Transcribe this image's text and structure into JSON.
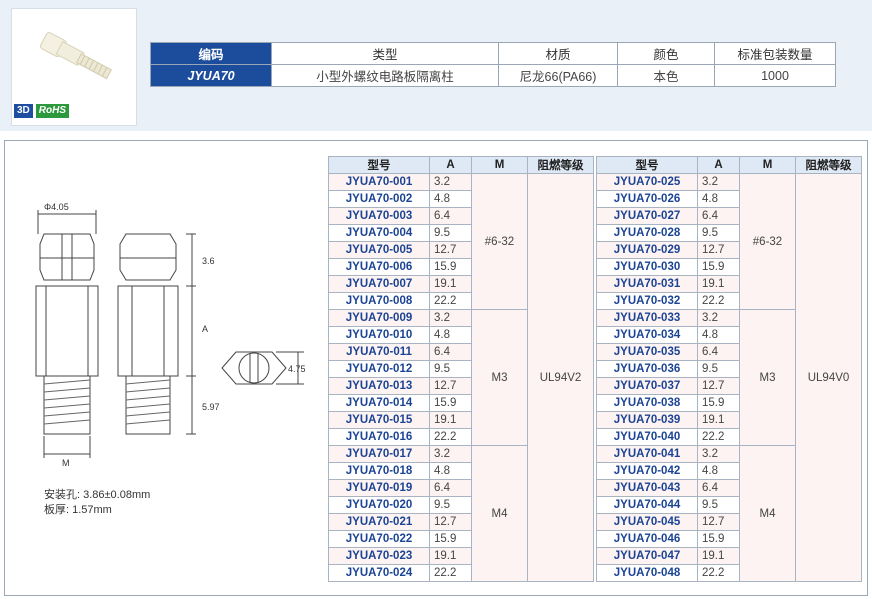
{
  "info_table": {
    "headers": [
      "编码",
      "类型",
      "材质",
      "颜色",
      "标准包装数量"
    ],
    "row": [
      "JYUA70",
      "小型外螺纹电路板隔离柱",
      "尼龙66(PA66)",
      "本色",
      "1000"
    ]
  },
  "badges": {
    "d3": "3D",
    "rohs": "RoHS"
  },
  "drawing": {
    "dia_label": "Φ4.05",
    "dim_top": "3.6",
    "dim_mid": "A",
    "dim_bottom": "5.97",
    "dim_hex": "4.75",
    "thread_label": "M"
  },
  "notes": {
    "hole": "安装孔: 3.86±0.08mm",
    "board": "板厚: 1.57mm"
  },
  "spec_headers": [
    "型号",
    "A",
    "M",
    "阻燃等级"
  ],
  "spec_left": {
    "models": [
      "JYUA70-001",
      "JYUA70-002",
      "JYUA70-003",
      "JYUA70-004",
      "JYUA70-005",
      "JYUA70-006",
      "JYUA70-007",
      "JYUA70-008",
      "JYUA70-009",
      "JYUA70-010",
      "JYUA70-011",
      "JYUA70-012",
      "JYUA70-013",
      "JYUA70-014",
      "JYUA70-015",
      "JYUA70-016",
      "JYUA70-017",
      "JYUA70-018",
      "JYUA70-019",
      "JYUA70-020",
      "JYUA70-021",
      "JYUA70-022",
      "JYUA70-023",
      "JYUA70-024"
    ],
    "a_values": [
      "3.2",
      "4.8",
      "6.4",
      "9.5",
      "12.7",
      "15.9",
      "19.1",
      "22.2",
      "3.2",
      "4.8",
      "6.4",
      "9.5",
      "12.7",
      "15.9",
      "19.1",
      "22.2",
      "3.2",
      "4.8",
      "6.4",
      "9.5",
      "12.7",
      "15.9",
      "19.1",
      "22.2"
    ],
    "m_groups": [
      "#6-32",
      "M3",
      "M4"
    ],
    "flame": "UL94V2"
  },
  "spec_right": {
    "models": [
      "JYUA70-025",
      "JYUA70-026",
      "JYUA70-027",
      "JYUA70-028",
      "JYUA70-029",
      "JYUA70-030",
      "JYUA70-031",
      "JYUA70-032",
      "JYUA70-033",
      "JYUA70-034",
      "JYUA70-035",
      "JYUA70-036",
      "JYUA70-037",
      "JYUA70-038",
      "JYUA70-039",
      "JYUA70-040",
      "JYUA70-041",
      "JYUA70-042",
      "JYUA70-043",
      "JYUA70-044",
      "JYUA70-045",
      "JYUA70-046",
      "JYUA70-047",
      "JYUA70-048"
    ],
    "a_values": [
      "3.2",
      "4.8",
      "6.4",
      "9.5",
      "12.7",
      "15.9",
      "19.1",
      "22.2",
      "3.2",
      "4.8",
      "6.4",
      "9.5",
      "12.7",
      "15.9",
      "19.1",
      "22.2",
      "3.2",
      "4.8",
      "6.4",
      "9.5",
      "12.7",
      "15.9",
      "19.1",
      "22.2"
    ],
    "m_groups": [
      "#6-32",
      "M3",
      "M4"
    ],
    "flame": "UL94V0"
  },
  "icons": [
    "product-photo-icon",
    "standoff-drawing-icon",
    "hex-end-view-icon"
  ]
}
